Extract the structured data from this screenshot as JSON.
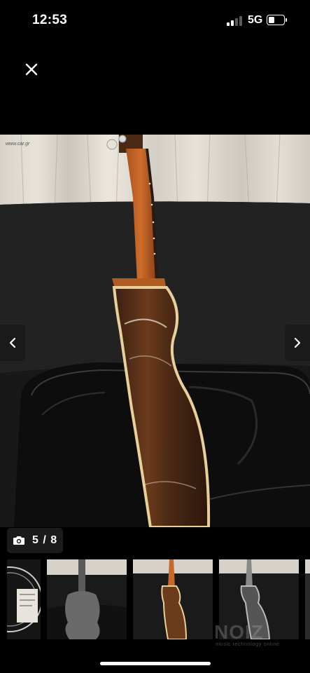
{
  "status_bar": {
    "time": "12:53",
    "network": "5G",
    "signal_icon": "signal-bars-icon",
    "battery_icon": "battery-icon",
    "battery_level": 0.3
  },
  "viewer": {
    "close_icon": "close-icon",
    "prev_icon": "chevron-left-icon",
    "next_icon": "chevron-right-icon",
    "photo_watermark": "www.car.gr",
    "counter_icon": "camera-icon",
    "counter": "5 / 8"
  },
  "thumbnails": [
    {
      "name": "label inside soundhole",
      "active": false
    },
    {
      "name": "back of guitar",
      "active": false
    },
    {
      "name": "side of guitar",
      "active": true
    },
    {
      "name": "side of guitar b&w",
      "active": false
    },
    {
      "name": "partial",
      "active": false
    }
  ],
  "watermark": {
    "logo": "NOIZ",
    "tagline": "music technology online"
  }
}
